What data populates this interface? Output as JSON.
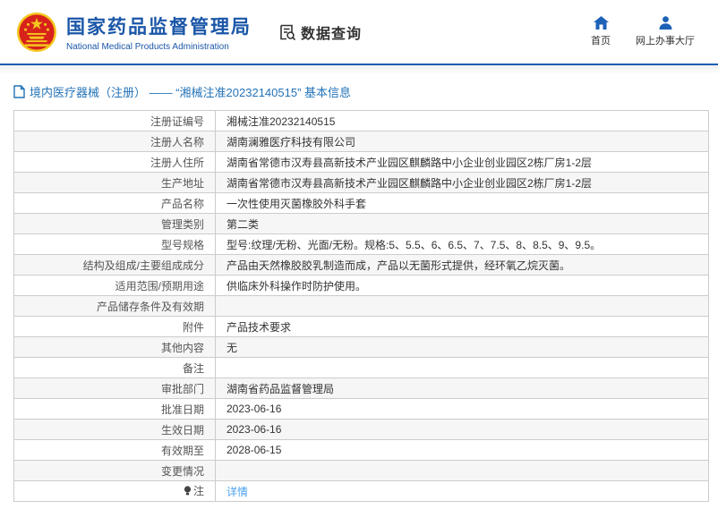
{
  "header": {
    "title_cn": "国家药品监督管理局",
    "title_en": "National Medical Products Administration",
    "emblem_icon": "china-national-emblem-icon",
    "data_query": {
      "label": "数据查询",
      "icon": "document-search-icon"
    },
    "nav": [
      {
        "label": "首页",
        "icon": "home-icon"
      },
      {
        "label": "网上办事大厅",
        "icon": "user-icon"
      }
    ]
  },
  "breadcrumb": {
    "icon": "document-icon",
    "text": "境内医疗器械（注册） —— “湘械注准20232140515” 基本信息"
  },
  "table": {
    "rows": [
      {
        "label": "注册证编号",
        "value": "湘械注准20232140515"
      },
      {
        "label": "注册人名称",
        "value": "湖南澜雅医疗科技有限公司"
      },
      {
        "label": "注册人住所",
        "value": "湖南省常德市汉寿县高新技术产业园区麒麟路中小企业创业园区2栋厂房1-2层"
      },
      {
        "label": "生产地址",
        "value": "湖南省常德市汉寿县高新技术产业园区麒麟路中小企业创业园区2栋厂房1-2层"
      },
      {
        "label": "产品名称",
        "value": "一次性使用灭菌橡胶外科手套"
      },
      {
        "label": "管理类别",
        "value": "第二类"
      },
      {
        "label": "型号规格",
        "value": "型号:纹理/无粉、光面/无粉。规格:5、5.5、6、6.5、7、7.5、8、8.5、9、9.5。"
      },
      {
        "label": "结构及组成/主要组成成分",
        "value": "产品由天然橡胶胶乳制造而成，产品以无菌形式提供，经环氧乙烷灭菌。"
      },
      {
        "label": "适用范围/预期用途",
        "value": "供临床外科操作时防护使用。"
      },
      {
        "label": "产品储存条件及有效期",
        "value": ""
      },
      {
        "label": "附件",
        "value": "产品技术要求"
      },
      {
        "label": "其他内容",
        "value": "无"
      },
      {
        "label": "备注",
        "value": ""
      },
      {
        "label": "审批部门",
        "value": "湖南省药品监督管理局"
      },
      {
        "label": "批准日期",
        "value": "2023-06-16"
      },
      {
        "label": "生效日期",
        "value": "2023-06-16"
      },
      {
        "label": "有效期至",
        "value": "2028-06-15"
      },
      {
        "label": "变更情况",
        "value": ""
      },
      {
        "label": "注",
        "value": "详情",
        "label_icon": "bulb-icon",
        "value_is_link": true
      }
    ]
  },
  "colors": {
    "brand_blue": "#1a56a8",
    "separator_blue": "#1a5db4",
    "breadcrumb_blue": "#2273b8",
    "link_blue": "#4aa0ee",
    "emblem_red": "#d8231c",
    "emblem_gold": "#f4c71e",
    "border_gray": "#cccccc",
    "stripe_gray": "#f6f6f7"
  }
}
